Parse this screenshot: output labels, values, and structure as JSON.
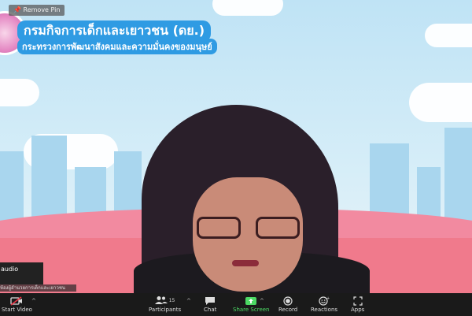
{
  "pin": {
    "label": "Remove Pin"
  },
  "banner": {
    "title": "กรมกิจการเด็กและเยาวชน (ดย.)",
    "subtitle": "กระทรวงการพัฒนาสังคมและความมั่นคงของมนุษย์"
  },
  "participant": {
    "name_tag": "audio",
    "caption": "ห้องผู้อำนวยการเด็กและเยาวชน"
  },
  "toolbar": {
    "start_video": "Start Video",
    "participants": "Participants",
    "participants_count": "15",
    "chat": "Chat",
    "share_screen": "Share Screen",
    "record": "Record",
    "reactions": "Reactions",
    "apps": "Apps"
  },
  "colors": {
    "toolbar_bg": "#1a1a1a",
    "share_green": "#4cd964",
    "banner_blue": "#2f9be3"
  }
}
